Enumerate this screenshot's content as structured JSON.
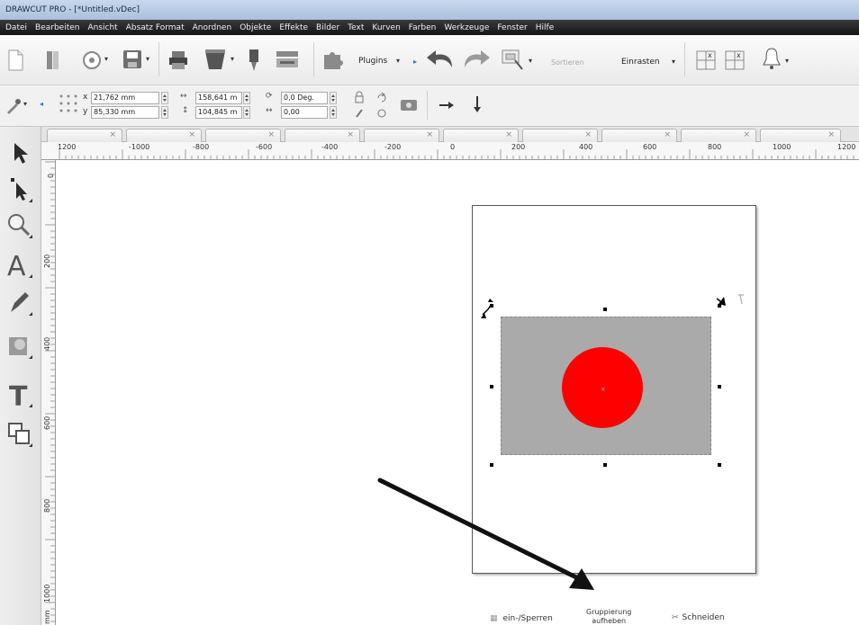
{
  "window": {
    "title": "DRAWCUT PRO - [*Untitled.vDec]"
  },
  "menu": [
    "Datei",
    "Bearbeiten",
    "Ansicht",
    "Absatz Format",
    "Anordnen",
    "Objekte",
    "Effekte",
    "Bilder",
    "Text",
    "Kurven",
    "Farben",
    "Werkzeuge",
    "Fenster",
    "Hilfe"
  ],
  "toolbar": {
    "plugins_label": "Plugins",
    "sort_label": "Sortieren",
    "snap_label": "Einrasten",
    "icons": [
      "new-document-icon",
      "open-icon",
      "import-icon",
      "save-icon",
      "print-icon",
      "cut-icon",
      "knife-icon",
      "plotter-icon",
      "puzzle-icon",
      "undo-icon",
      "redo-icon",
      "select-area-icon",
      "grid-icon",
      "bell-icon"
    ]
  },
  "properties": {
    "x_label": "x",
    "x_value": "21,762 mm",
    "y_label": "y",
    "y_value": "85,330 mm",
    "width_value": "158,641 m",
    "height_value": "104,845 m",
    "rotation_value": "0,0 Deg.",
    "skew_value": "0,00"
  },
  "tabs": [
    "×",
    "×",
    "×",
    "×",
    "×",
    "×",
    "×",
    "×",
    "×",
    "×"
  ],
  "ruler": {
    "horizontal": [
      "1200",
      "-1000",
      "-800",
      "-600",
      "-400",
      "-200",
      "0",
      "200",
      "400",
      "600",
      "800",
      "1000",
      "1200"
    ],
    "vertical": [
      "0",
      "200",
      "400",
      "600",
      "800",
      "1000"
    ],
    "unit": "mm"
  },
  "canvas": {
    "rect_color": "#aaaaaa",
    "circle_color": "#ff0000",
    "center_mark": "×"
  },
  "context_bar": {
    "lock_label": "ein-/Sperren",
    "ungroup_line1": "Gruppierung",
    "ungroup_line2": "aufheben",
    "cut_label": "Schneiden"
  }
}
